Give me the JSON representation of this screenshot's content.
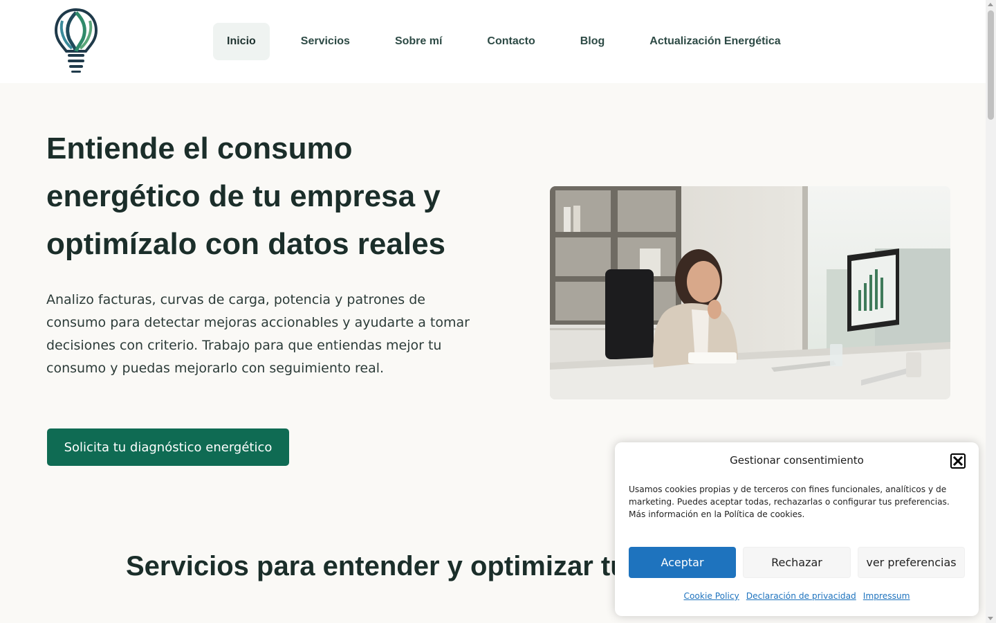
{
  "header": {
    "logo_icon": "lightbulb-leaf-logo",
    "nav": [
      {
        "label": "Inicio",
        "active": true
      },
      {
        "label": "Servicios"
      },
      {
        "label": "Sobre mí"
      },
      {
        "label": "Contacto"
      },
      {
        "label": "Blog"
      },
      {
        "label": "Actualización Energética"
      }
    ]
  },
  "hero": {
    "title": "Entiende el consumo energético de tu empresa y optimízalo con datos reales",
    "text": "Analizo facturas, curvas de carga, potencia y patrones de consumo para detectar mejoras accionables y ayudarte a tomar decisiones con criterio. Trabajo para que entiendas mejor tu consumo y puedas mejorarlo con seguimiento real.",
    "cta_label": "Solicita tu diagnóstico energético",
    "image_icon": "woman-at-desk-photo"
  },
  "services": {
    "title": "Servicios para entender y optimizar tu c"
  },
  "cookie": {
    "title": "Gestionar consentimiento",
    "text": "Usamos cookies propias y de terceros con fines funcionales, analíticos y de marketing. Puedes aceptar todas, rechazarlas o configurar tus preferencias. Más información en la Política de cookies.",
    "accept_label": "Aceptar",
    "deny_label": "Rechazar",
    "prefs_label": "ver preferencias",
    "links": [
      "Cookie Policy",
      "Declaración de privacidad",
      "Impressum"
    ]
  },
  "colors": {
    "brand_green": "#0f6b53",
    "accept_blue": "#1e73be",
    "page_bg": "#faf9f6"
  }
}
